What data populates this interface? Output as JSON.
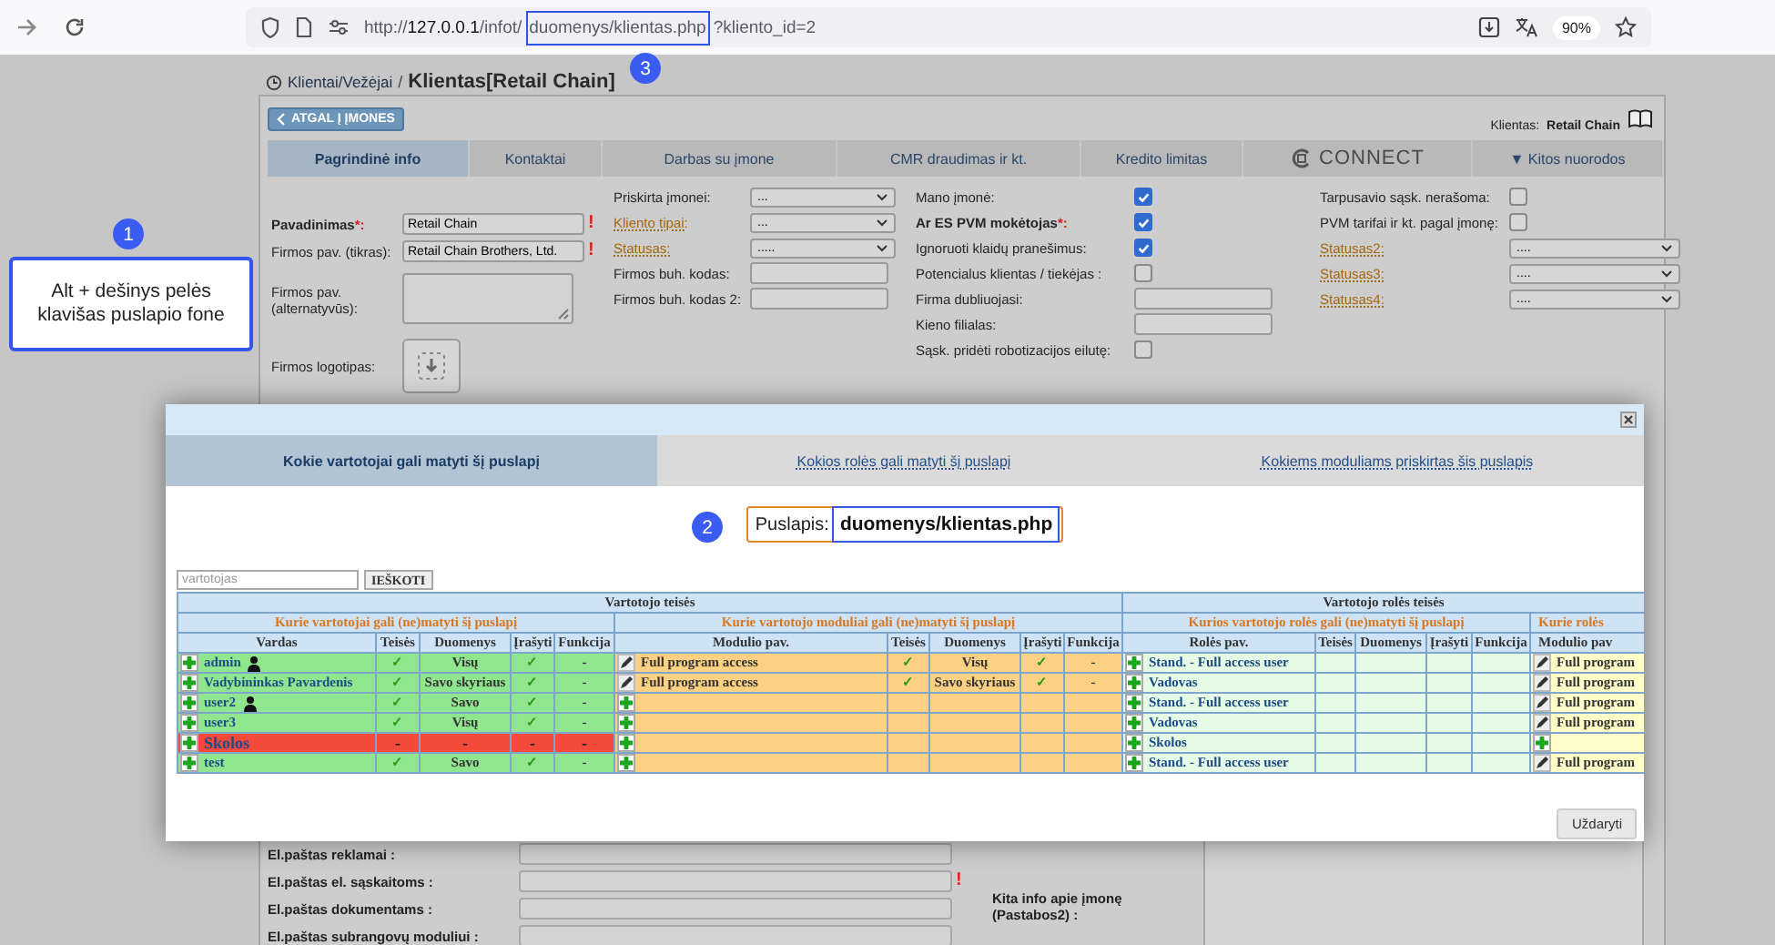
{
  "browser": {
    "url_parts": [
      {
        "kind": "dim",
        "text": "http://"
      },
      {
        "kind": "host",
        "text": "127.0.0.1"
      },
      {
        "kind": "dim",
        "text": "/infot/"
      },
      {
        "kind": "highlight",
        "text": "duomenys/klientas.php"
      },
      {
        "kind": "dim",
        "text": "?kliento_id=2"
      }
    ],
    "zoom": "90%"
  },
  "breadcrumb": {
    "link": "Klientai/Vežėjai",
    "separator": "/",
    "title": "Klientas[Retail Chain]"
  },
  "back_button": "ATGAL Į ĮMONES",
  "client": {
    "label": "Klientas:",
    "name": "Retail Chain"
  },
  "tabs": [
    {
      "label": "Pagrindinė info",
      "kind": "text",
      "selected": true
    },
    {
      "label": "Kontaktai",
      "kind": "text",
      "selected": false
    },
    {
      "label": "Darbas su įmone",
      "kind": "text",
      "selected": false
    },
    {
      "label": "CMR draudimas ir kt.",
      "kind": "text",
      "selected": false
    },
    {
      "label": "Kredito limitas",
      "kind": "text",
      "selected": false
    },
    {
      "label": "CONNECT",
      "kind": "logo",
      "selected": false
    },
    {
      "label": "▼ Kitos nuorodos",
      "kind": "text",
      "selected": false
    }
  ],
  "form_columns": [
    [
      {
        "kind": "text",
        "label": "Pavadinimas",
        "required": "*:",
        "link": false,
        "value": "Retail Chain",
        "error": "!"
      },
      {
        "kind": "text",
        "label": "Firmos pav. (tikras):",
        "link": false,
        "value": "Retail Chain Brothers, Ltd.",
        "error": "!"
      },
      {
        "kind": "textarea",
        "label": "Firmos pav. (alternatyvūs):",
        "link": false
      },
      {
        "kind": "upload",
        "label": "Firmos logotipas:",
        "link": false
      }
    ],
    [
      {
        "kind": "select",
        "label": "Priskirta įmonei:",
        "link": false,
        "value": "..."
      },
      {
        "kind": "select",
        "label": "Kliento tipai:",
        "link": true,
        "value": "..."
      },
      {
        "kind": "select",
        "label": "Statusas:",
        "link": true,
        "value": "....."
      },
      {
        "kind": "text",
        "label": "Firmos buh. kodas:",
        "link": false
      },
      {
        "kind": "text",
        "label": "Firmos buh. kodas 2:",
        "link": false
      }
    ],
    [
      {
        "kind": "checkbox",
        "label": "Mano įmonė:",
        "link": false,
        "checked": true
      },
      {
        "kind": "checkbox",
        "label": "Ar ES PVM mokėtojas",
        "required": "*:",
        "link": false,
        "checked": true
      },
      {
        "kind": "checkbox",
        "label": "Ignoruoti klaidų pranešimus:",
        "link": false,
        "checked": true
      },
      {
        "kind": "checkbox",
        "label": "Potencialus klientas / tiekėjas :",
        "link": false,
        "checked": false
      },
      {
        "kind": "text",
        "label": "Firma dubliuojasi:",
        "link": false
      },
      {
        "kind": "text",
        "label": "Kieno filialas:",
        "link": false
      },
      {
        "kind": "checkbox",
        "label": "Sąsk. pridėti robotizacijos eilutę:",
        "link": false,
        "checked": false
      }
    ],
    [
      {
        "kind": "checkbox",
        "label": "Tarpusavio sąsk. nerašoma:",
        "link": false,
        "checked": false
      },
      {
        "kind": "checkbox",
        "label": "PVM tarifai ir kt. pagal įmonę:",
        "link": false,
        "checked": false
      },
      {
        "kind": "select",
        "label": "Statusas2:",
        "link": true,
        "value": "...."
      },
      {
        "kind": "select",
        "label": "Statusas3:",
        "link": true,
        "value": "...."
      },
      {
        "kind": "select",
        "label": "Statusas4:",
        "link": true,
        "value": "...."
      }
    ]
  ],
  "emails": [
    {
      "label": "El.paštas reklamai :"
    },
    {
      "label": "El.paštas el. sąskaitoms :",
      "error": "!"
    },
    {
      "label": "El.paštas dokumentams :"
    },
    {
      "label": "El.paštas subrangovų moduliui :"
    }
  ],
  "notes": {
    "label": "Kita info apie įmonę (Pastabos2) :"
  },
  "modal": {
    "tabs": [
      {
        "label": "Kokie vartotojai gali matyti šį puslapį",
        "selected": true
      },
      {
        "label": "Kokios rolės gali matyti šį puslapį",
        "selected": false
      },
      {
        "label": "Kokiems moduliams priskirtas šis puslapis",
        "selected": false
      }
    ],
    "page_label": "Puslapis:",
    "page_path": "duomenys/klientas.php",
    "search": {
      "placeholder": "vartotojas",
      "button": "IEŠKOTI"
    },
    "table": {
      "groups": [
        "Vartotojo teisės",
        "Vartotojo rolės teisės"
      ],
      "subgroups": [
        "Kurie vartotojai gali (ne)matyti šį puslapį",
        "Kurie vartotojo moduliai gali (ne)matyti šį puslapį",
        "Kurios vartotojo rolės gali (ne)matyti šį puslapį",
        "Kurie rolės"
      ],
      "columns": [
        "Vardas",
        "Teisės",
        "Duomenys",
        "Įrašyti",
        "Funkcija",
        "Modulio pav.",
        "Teisės",
        "Duomenys",
        "Įrašyti",
        "Funkcija",
        "Rolės pav.",
        "Teisės",
        "Duomenys",
        "Įrašyti",
        "Funkcija",
        "Modulio pav"
      ],
      "rows": [
        {
          "name": "admin",
          "person": true,
          "denied": false,
          "rights": "✓",
          "data": "Visų",
          "write": "✓",
          "function": "-",
          "module": {
            "assigned": true,
            "name": "Full program access",
            "rights": "✓",
            "data": "Visų",
            "write": "✓",
            "function": "-"
          },
          "role": "Stand. - Full access user",
          "role_module": {
            "assigned": true,
            "name": "Full program"
          }
        },
        {
          "name": "Vadybininkas Pavardenis",
          "person": false,
          "denied": false,
          "rights": "✓",
          "data": "Savo skyriaus",
          "write": "✓",
          "function": "-",
          "module": {
            "assigned": true,
            "name": "Full program access",
            "rights": "✓",
            "data": "Savo skyriaus",
            "write": "✓",
            "function": "-"
          },
          "role": "Vadovas",
          "role_module": {
            "assigned": true,
            "name": "Full program"
          }
        },
        {
          "name": "user2",
          "person": true,
          "denied": false,
          "rights": "✓",
          "data": "Savo",
          "write": "✓",
          "function": "-",
          "module": {
            "assigned": false
          },
          "role": "Stand. - Full access user",
          "role_module": {
            "assigned": true,
            "name": "Full program"
          }
        },
        {
          "name": "user3",
          "person": false,
          "denied": false,
          "rights": "✓",
          "data": "Visų",
          "write": "✓",
          "function": "-",
          "module": {
            "assigned": false
          },
          "role": "Vadovas",
          "role_module": {
            "assigned": true,
            "name": "Full program"
          }
        },
        {
          "name": "Skolos",
          "person": false,
          "denied": true,
          "rights": "-",
          "data": "-",
          "write": "-",
          "function": "-",
          "module": {
            "assigned": false
          },
          "role": "Skolos",
          "role_module": {
            "assigned": false
          }
        },
        {
          "name": "test",
          "person": false,
          "denied": false,
          "rights": "✓",
          "data": "Savo",
          "write": "✓",
          "function": "-",
          "module": {
            "assigned": false
          },
          "role": "Stand. - Full access user",
          "role_module": {
            "assigned": true,
            "name": "Full program"
          }
        }
      ]
    },
    "close_button": "Uždaryti"
  },
  "annotations": [
    {
      "number": "1",
      "text": "Alt + dešinys pelės klavišas puslapio fone"
    },
    {
      "number": "2"
    },
    {
      "number": "3"
    }
  ]
}
